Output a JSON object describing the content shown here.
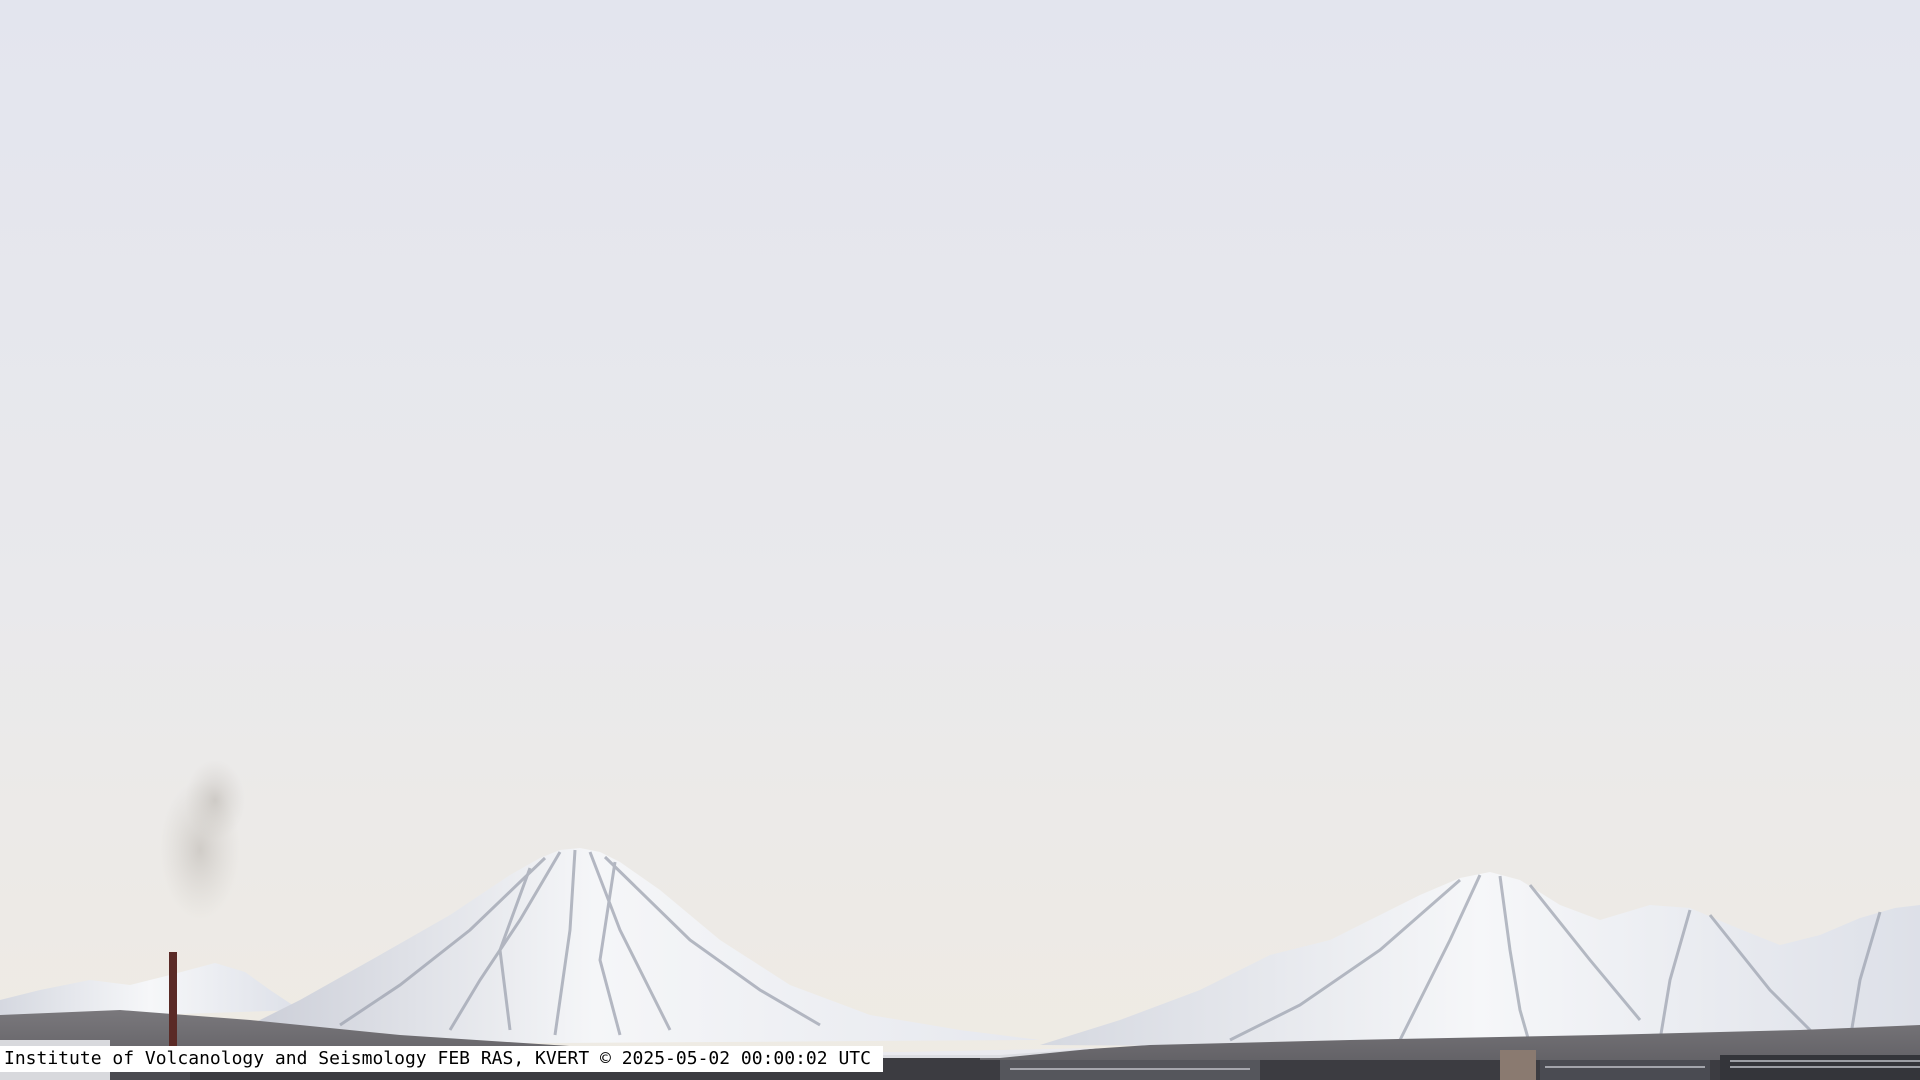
{
  "camera": {
    "caption": "Institute of Volcanology and Seismology FEB RAS, KVERT © 2025-05-02 00:00:02 UTC"
  },
  "colors": {
    "sky_top": "#e4e6ef",
    "sky_horizon": "#eeebe3",
    "snow": "#f4f5f7",
    "rock_shadow": "#8a8f9c",
    "foothills": "#6e6c70",
    "city": "#3a3a3e",
    "caption_bg": "#ffffff",
    "caption_text": "#000000"
  }
}
